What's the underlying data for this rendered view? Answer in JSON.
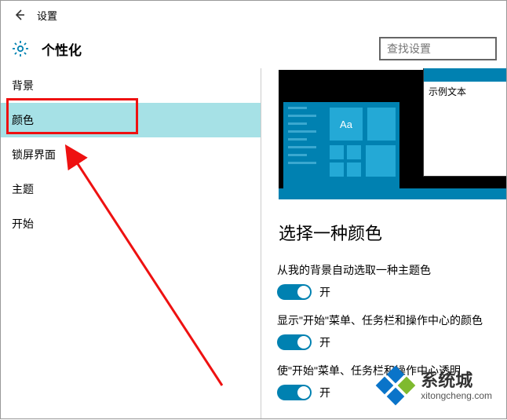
{
  "titlebar": {
    "app_title": "设置"
  },
  "header": {
    "page_title": "个性化",
    "search_placeholder": "查找设置"
  },
  "sidebar": {
    "items": [
      {
        "label": "背景"
      },
      {
        "label": "颜色"
      },
      {
        "label": "锁屏界面"
      },
      {
        "label": "主题"
      },
      {
        "label": "开始"
      }
    ],
    "selected_index": 1
  },
  "preview": {
    "sample_text": "示例文本",
    "tile_text": "Aa"
  },
  "section": {
    "title": "选择一种颜色"
  },
  "settings": [
    {
      "label": "从我的背景自动选取一种主题色",
      "state": "开"
    },
    {
      "label": "显示\"开始\"菜单、任务栏和操作中心的颜色",
      "state": "开"
    },
    {
      "label": "使\"开始\"菜单、任务栏和操作中心透明",
      "state": "开"
    }
  ],
  "watermark": {
    "cn": "系统城",
    "en": "xitongcheng.com"
  }
}
